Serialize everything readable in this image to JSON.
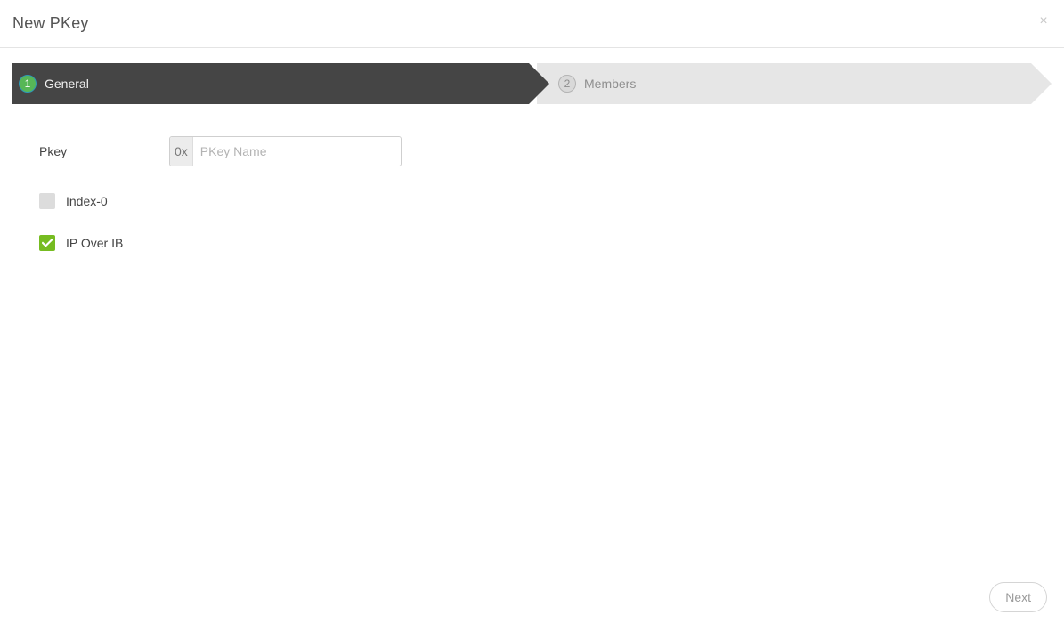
{
  "dialog": {
    "title": "New PKey",
    "close_icon": "close-icon",
    "close_glyph": "×"
  },
  "wizard": {
    "steps": [
      {
        "number": "1",
        "label": "General",
        "state": "active"
      },
      {
        "number": "2",
        "label": "Members",
        "state": "inactive"
      }
    ]
  },
  "form": {
    "pkey": {
      "label": "Pkey",
      "prefix": "0x",
      "value": "",
      "placeholder": "PKey Name"
    },
    "checkboxes": [
      {
        "label": "Index-0",
        "checked": false
      },
      {
        "label": "IP Over IB",
        "checked": true
      }
    ]
  },
  "footer": {
    "next_label": "Next"
  },
  "colors": {
    "step_active_bg": "#454545",
    "step_inactive_bg": "#e6e6e6",
    "badge_active": "#57b757",
    "checkbox_checked": "#76bc21",
    "checkbox_unchecked": "#dcdcdc"
  }
}
